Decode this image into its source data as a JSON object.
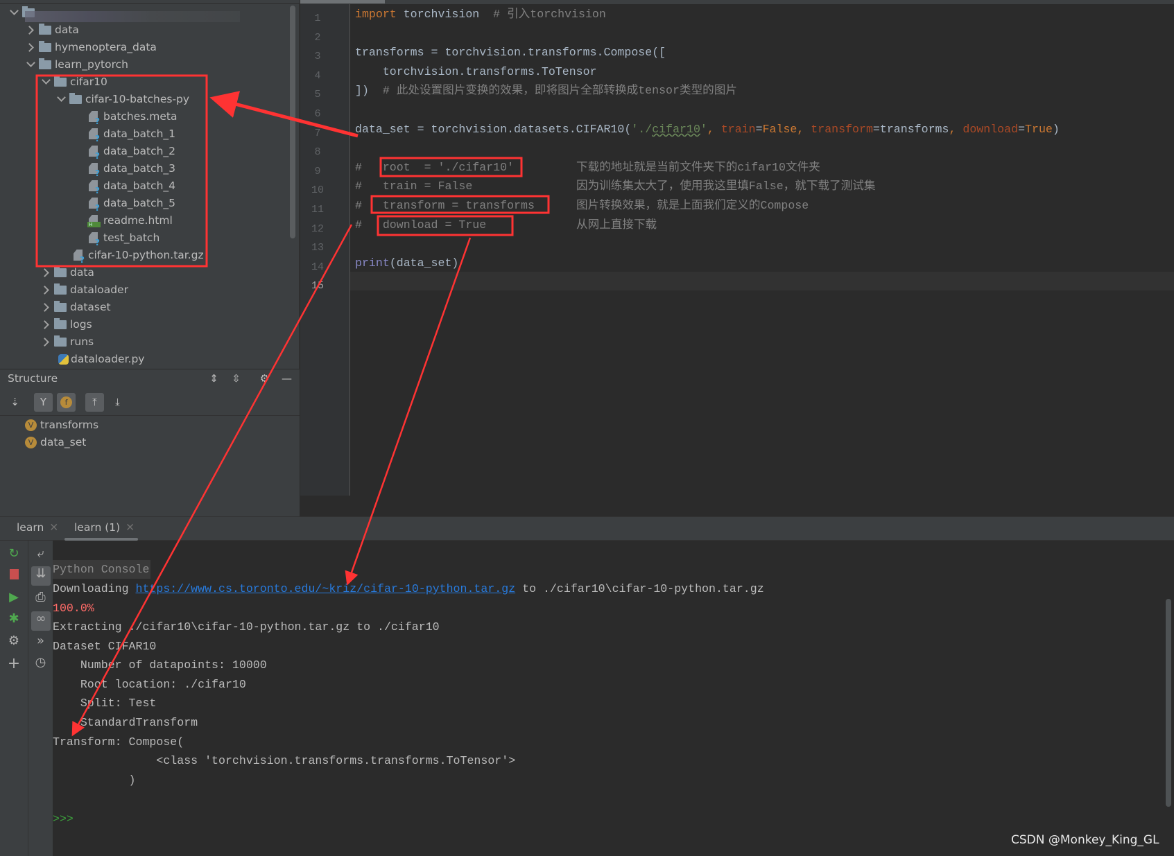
{
  "project_tree": [
    {
      "label": "",
      "level": 0,
      "kind": "root",
      "state": "open",
      "blurred": true
    },
    {
      "label": "data",
      "level": 1,
      "kind": "folder",
      "state": "closed"
    },
    {
      "label": "hymenoptera_data",
      "level": 1,
      "kind": "folder",
      "state": "closed"
    },
    {
      "label": "learn_pytorch",
      "level": 1,
      "kind": "folder",
      "state": "open"
    },
    {
      "label": "cifar10",
      "level": 2,
      "kind": "folder",
      "state": "open"
    },
    {
      "label": "cifar-10-batches-py",
      "level": 3,
      "kind": "folder",
      "state": "open"
    },
    {
      "label": "batches.meta",
      "level": 4,
      "kind": "unknown-file"
    },
    {
      "label": "data_batch_1",
      "level": 4,
      "kind": "unknown-file"
    },
    {
      "label": "data_batch_2",
      "level": 4,
      "kind": "unknown-file"
    },
    {
      "label": "data_batch_3",
      "level": 4,
      "kind": "unknown-file"
    },
    {
      "label": "data_batch_4",
      "level": 4,
      "kind": "unknown-file"
    },
    {
      "label": "data_batch_5",
      "level": 4,
      "kind": "unknown-file"
    },
    {
      "label": "readme.html",
      "level": 4,
      "kind": "html-file"
    },
    {
      "label": "test_batch",
      "level": 4,
      "kind": "unknown-file"
    },
    {
      "label": "cifar-10-python.tar.gz",
      "level": 3,
      "kind": "unknown-file"
    },
    {
      "label": "data",
      "level": 2,
      "kind": "folder",
      "state": "closed"
    },
    {
      "label": "dataloader",
      "level": 2,
      "kind": "folder",
      "state": "closed"
    },
    {
      "label": "dataset",
      "level": 2,
      "kind": "folder",
      "state": "closed"
    },
    {
      "label": "logs",
      "level": 2,
      "kind": "folder",
      "state": "closed"
    },
    {
      "label": "runs",
      "level": 2,
      "kind": "folder",
      "state": "closed"
    },
    {
      "label": "dataloader.py",
      "level": 2,
      "kind": "python-file"
    }
  ],
  "structure": {
    "title": "Structure",
    "items": [
      {
        "badge": "V",
        "label": "transforms"
      },
      {
        "badge": "V",
        "label": "data_set"
      }
    ],
    "toolbar_icons": [
      "sort-alpha-icon",
      "show-inherited-icon",
      "show-fields-icon",
      "expand-all-icon",
      "collapse-all-icon"
    ],
    "header_icons": [
      "expand-icon",
      "collapse-icon",
      "gear-icon",
      "minimize-icon"
    ]
  },
  "editor": {
    "current_line": 15,
    "lines": [
      [
        {
          "t": "import",
          "c": "kw"
        },
        {
          "t": " torchvision  ",
          "c": "tx"
        },
        {
          "t": "# 引入torchvision",
          "c": "cm"
        }
      ],
      [],
      [
        {
          "t": "transforms = torchvision.transforms.Compose([",
          "c": "tx"
        }
      ],
      [
        {
          "t": "    torchvision.transforms.ToTensor",
          "c": "tx"
        }
      ],
      [
        {
          "t": "])  ",
          "c": "tx"
        },
        {
          "t": "# 此处设置图片变换的效果，即将图片全部转换成tensor类型的图片",
          "c": "cm"
        }
      ],
      [],
      [
        {
          "t": "data_set = torchvision.datasets.CIFAR10(",
          "c": "tx"
        },
        {
          "t": "'./",
          "c": "st"
        },
        {
          "t": "cifar10",
          "c": "st ul"
        },
        {
          "t": "'",
          "c": "st"
        },
        {
          "t": ", ",
          "c": "kw"
        },
        {
          "t": "train",
          "c": "pm"
        },
        {
          "t": "=",
          "c": "tx"
        },
        {
          "t": "False",
          "c": "kw"
        },
        {
          "t": ", ",
          "c": "kw"
        },
        {
          "t": "transform",
          "c": "pm"
        },
        {
          "t": "=transforms",
          "c": "tx"
        },
        {
          "t": ", ",
          "c": "kw"
        },
        {
          "t": "download",
          "c": "pm"
        },
        {
          "t": "=",
          "c": "tx"
        },
        {
          "t": "True",
          "c": "kw"
        },
        {
          "t": ")",
          "c": "tx"
        }
      ],
      [],
      [
        {
          "t": "#   root  = './cifar10'",
          "c": "cm"
        }
      ],
      [
        {
          "t": "#   train = False",
          "c": "cm"
        }
      ],
      [
        {
          "t": "#   transform = transforms",
          "c": "cm"
        }
      ],
      [
        {
          "t": "#   download = True",
          "c": "cm"
        }
      ],
      [],
      [
        {
          "t": "print",
          "c": "bi"
        },
        {
          "t": "(data_set)",
          "c": "tx"
        }
      ],
      []
    ],
    "side_comments": {
      "9": "下载的地址就是当前文件夹下的cifar10文件夹",
      "10": "因为训练集太大了，使用我这里填False，就下载了测试集",
      "11": "图片转换效果，就是上面我们定义的Compose",
      "12": "从网上直接下载"
    }
  },
  "console_tabs": [
    {
      "label": "learn",
      "active": false
    },
    {
      "label": "learn (1)",
      "active": true
    }
  ],
  "console": {
    "header": "Python Console",
    "download_prefix": "Downloading ",
    "download_url": "https://www.cs.toronto.edu/~kriz/cifar-10-python.tar.gz",
    "download_suffix": " to ./cifar10\\cifar-10-python.tar.gz",
    "progress": "100.0%",
    "lines": [
      "Extracting ./cifar10\\cifar-10-python.tar.gz to ./cifar10",
      "Dataset CIFAR10",
      "    Number of datapoints: 10000",
      "    Root location: ./cifar10",
      "    Split: Test",
      "    StandardTransform",
      "Transform: Compose(",
      "               <class 'torchvision.transforms.transforms.ToTensor'>",
      "           )"
    ],
    "prompt": ">>>"
  },
  "console_toolbar_left": [
    "rerun-icon",
    "stop-icon",
    "run-icon",
    "debug-icon",
    "settings-icon",
    "add-icon"
  ],
  "console_toolbar_right": [
    "soft-wrap-icon",
    "scroll-to-end-icon",
    "print-icon",
    "show-variables-icon",
    "execute-icon",
    "history-icon"
  ],
  "watermark": "CSDN @Monkey_King_GL",
  "annotation_color": "#ff3333"
}
